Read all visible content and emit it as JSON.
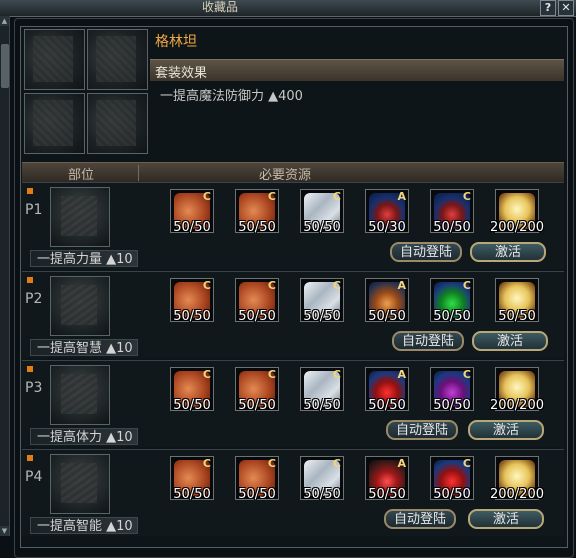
{
  "window": {
    "title": "收藏品",
    "help_label": "?",
    "close_label": "✕"
  },
  "header": {
    "set_name": "格林坦",
    "set_effect_label": "套装效果",
    "set_effect_text": "一提高魔法防御力 ▲400"
  },
  "columns": {
    "part": "部位",
    "resources": "必要资源"
  },
  "rows": [
    {
      "label": "P1",
      "bonus": "一提高力量 ▲10",
      "slots": [
        {
          "icon": "scroll-icon",
          "grade": "C",
          "count": "50/50"
        },
        {
          "icon": "scroll-icon",
          "grade": "C",
          "count": "50/50"
        },
        {
          "icon": "cloth-icon",
          "grade": "C",
          "count": "50/50"
        },
        {
          "icon": "potion-icon",
          "grade": "A",
          "count": "50/30"
        },
        {
          "icon": "potion-icon",
          "grade": "C",
          "count": "50/50"
        },
        {
          "icon": "crystal-icon",
          "grade": "",
          "count": "200/200"
        }
      ],
      "auto_label": "自动登陆",
      "activate_label": "激活"
    },
    {
      "label": "P2",
      "bonus": "一提高智慧 ▲10",
      "slots": [
        {
          "icon": "scroll-icon",
          "grade": "C",
          "count": "50/50"
        },
        {
          "icon": "scroll-icon",
          "grade": "C",
          "count": "50/50"
        },
        {
          "icon": "cloth-icon",
          "grade": "C",
          "count": "50/50"
        },
        {
          "icon": "potion-icon",
          "grade": "A",
          "count": "50/50"
        },
        {
          "icon": "potion-icon",
          "grade": "C",
          "count": "50/50"
        },
        {
          "icon": "crystal-icon",
          "grade": "",
          "count": "50/50"
        }
      ],
      "auto_label": "自动登陆",
      "activate_label": "激活"
    },
    {
      "label": "P3",
      "bonus": "一提高体力 ▲10",
      "slots": [
        {
          "icon": "scroll-icon",
          "grade": "C",
          "count": "50/50"
        },
        {
          "icon": "scroll-icon",
          "grade": "C",
          "count": "50/50"
        },
        {
          "icon": "cloth-icon",
          "grade": "C",
          "count": "50/50"
        },
        {
          "icon": "potion-icon",
          "grade": "A",
          "count": "50/50"
        },
        {
          "icon": "potion-icon",
          "grade": "C",
          "count": "50/50"
        },
        {
          "icon": "crystal-icon",
          "grade": "",
          "count": "200/200"
        }
      ],
      "auto_label": "自动登陆",
      "activate_label": "激活"
    },
    {
      "label": "P4",
      "bonus": "一提高智能 ▲10",
      "slots": [
        {
          "icon": "scroll-icon",
          "grade": "C",
          "count": "50/50"
        },
        {
          "icon": "scroll-icon",
          "grade": "C",
          "count": "50/50"
        },
        {
          "icon": "cloth-icon",
          "grade": "C",
          "count": "50/50"
        },
        {
          "icon": "potion-icon",
          "grade": "A",
          "count": "50/50"
        },
        {
          "icon": "potion-icon",
          "grade": "C",
          "count": "50/50"
        },
        {
          "icon": "crystal-icon",
          "grade": "",
          "count": "200/200"
        }
      ],
      "auto_label": "自动登陆",
      "activate_label": "激活"
    }
  ],
  "colors": {
    "accent_orange": "#f0a843",
    "marker": "#e07d15",
    "grade_gold": "#f3d57e"
  }
}
